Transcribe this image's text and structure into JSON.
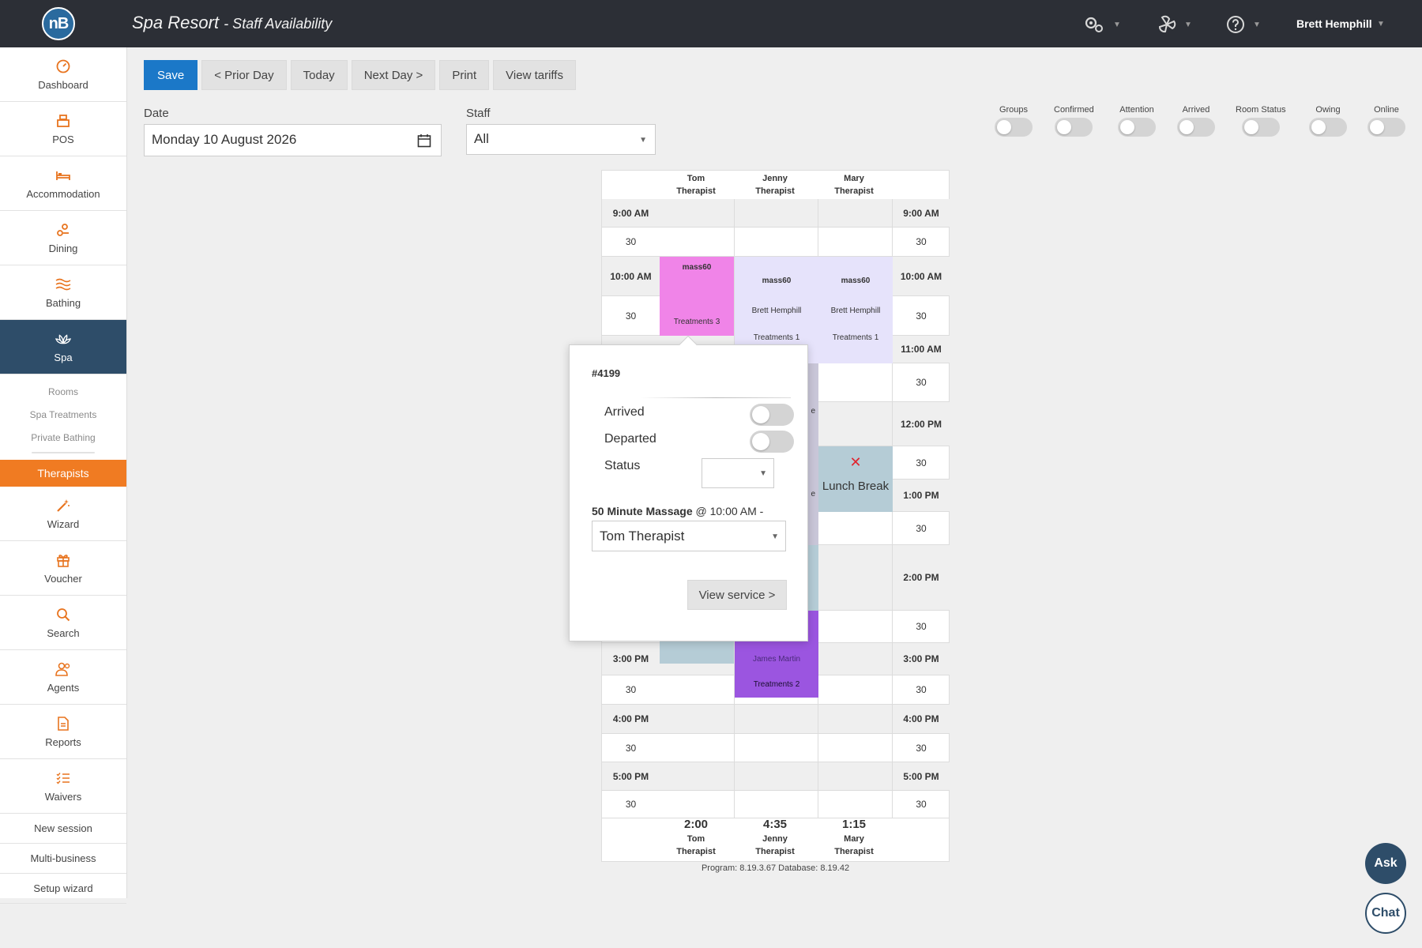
{
  "header": {
    "logo_text": "nB",
    "title": "Spa Resort",
    "subtitle": "- Staff Availability",
    "icons": [
      "settings-gear-icon",
      "fan-icon",
      "help-circle-icon"
    ],
    "user": "Brett Hemphill"
  },
  "sidebar": {
    "items": [
      {
        "label": "Dashboard",
        "icon": "speedometer-icon"
      },
      {
        "label": "POS",
        "icon": "register-icon"
      },
      {
        "label": "Accommodation",
        "icon": "bed-icon"
      },
      {
        "label": "Dining",
        "icon": "dining-icon"
      },
      {
        "label": "Bathing",
        "icon": "waves-icon"
      },
      {
        "label": "Spa",
        "icon": "lotus-icon"
      }
    ],
    "spa_sub": [
      "Rooms",
      "Spa Treatments",
      "Private Bathing"
    ],
    "active_sub": "Therapists",
    "items2": [
      {
        "label": "Wizard",
        "icon": "magic-wand-icon"
      },
      {
        "label": "Voucher",
        "icon": "gift-icon"
      },
      {
        "label": "Search",
        "icon": "search-icon"
      },
      {
        "label": "Agents",
        "icon": "people-icon"
      },
      {
        "label": "Reports",
        "icon": "document-icon"
      },
      {
        "label": "Waivers",
        "icon": "checklist-icon"
      }
    ],
    "text_items": [
      "New session",
      "Multi-business",
      "Setup wizard"
    ]
  },
  "toolbar": {
    "save": "Save",
    "prior": "< Prior Day",
    "today": "Today",
    "next": "Next Day >",
    "print": "Print",
    "tariffs": "View tariffs"
  },
  "form": {
    "date_label": "Date",
    "date_value": "Monday 10 August 2026",
    "staff_label": "Staff",
    "staff_value": "All"
  },
  "filters": [
    "Groups",
    "Confirmed",
    "Attention",
    "Arrived",
    "Room Status",
    "Owing",
    "Online"
  ],
  "schedule": {
    "columns": [
      {
        "first": "Tom",
        "last": "Therapist",
        "total": "2:00"
      },
      {
        "first": "Jenny",
        "last": "Therapist",
        "total": "4:35"
      },
      {
        "first": "Mary",
        "last": "Therapist",
        "total": "1:15"
      }
    ],
    "times_left": [
      "9:00 AM",
      "30",
      "10:00 AM",
      "30",
      "",
      "30",
      "",
      "30",
      "",
      "30",
      "",
      "30",
      "3:00 PM",
      "30",
      "4:00 PM",
      "30",
      "5:00 PM",
      "30"
    ],
    "times_right": [
      "9:00 AM",
      "30",
      "10:00 AM",
      "30",
      "11:00 AM",
      "30",
      "12:00 PM",
      "30",
      "1:00 PM",
      "30",
      "2:00 PM",
      "30",
      "3:00 PM",
      "30",
      "4:00 PM",
      "30",
      "5:00 PM",
      "30"
    ],
    "tom_appt": {
      "title": "mass60",
      "room": "Treatments 3",
      "color": "#f084e8"
    },
    "jenny_appt": {
      "title": "mass60",
      "guest": "Brett Hemphill",
      "room": "Treatments 1",
      "color": "#e6e3fb"
    },
    "mary_appt": {
      "title": "mass60",
      "guest": "Brett Hemphill",
      "room": "Treatments 1",
      "color": "#e6e3fb"
    },
    "jenny_appt2": {
      "guest": "James Martin",
      "room": "Treatments 2",
      "color": "#9b55e0"
    },
    "lunch": "Lunch Break",
    "edge_letter": "e",
    "remove_mark": "✕",
    "footer": "Program: 8.19.3.67 Database: 8.19.42"
  },
  "popup": {
    "ref": "#4199",
    "arrived": "Arrived",
    "departed": "Departed",
    "status": "Status",
    "service_name": "50 Minute Massage",
    "service_time": "@ 10:00 AM -",
    "therapist": "Tom Therapist",
    "view_service": "View service >"
  },
  "fabs": {
    "ask": "Ask",
    "chat": "Chat"
  },
  "colors": {
    "primary": "#1b78c8",
    "accent": "#f07b22",
    "nav_active": "#2e4d69",
    "lunch": "#b5ccd6"
  }
}
